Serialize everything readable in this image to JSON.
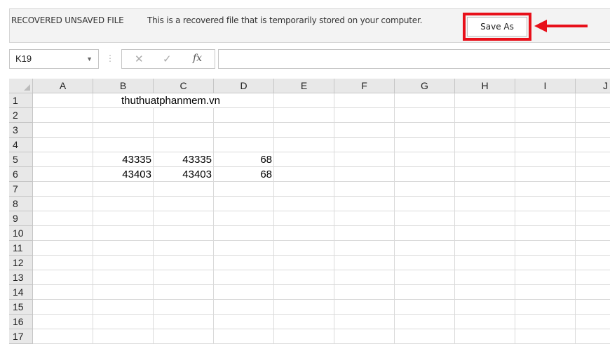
{
  "recovery_bar": {
    "title": "RECOVERED UNSAVED FILE",
    "message": "This is a recovered file that is temporarily stored on your computer.",
    "save_as_label": "Save As",
    "highlight_color": "#e8101a"
  },
  "formula_bar": {
    "name_box": "K19",
    "cancel_symbol": "✕",
    "enter_symbol": "✓",
    "fx_symbol": "fx",
    "formula_value": ""
  },
  "sheet": {
    "columns": [
      "A",
      "B",
      "C",
      "D",
      "E",
      "F",
      "G",
      "H",
      "I",
      "J"
    ],
    "rows": [
      "1",
      "2",
      "3",
      "4",
      "5",
      "6",
      "7",
      "8",
      "9",
      "10",
      "11",
      "12",
      "13",
      "14",
      "15",
      "16",
      "17"
    ],
    "cells": {
      "B1": "thuthuatphanmem.vn",
      "B5": "43335",
      "C5": "43335",
      "D5": "68",
      "B6": "43403",
      "C6": "43403",
      "D6": "68"
    }
  }
}
